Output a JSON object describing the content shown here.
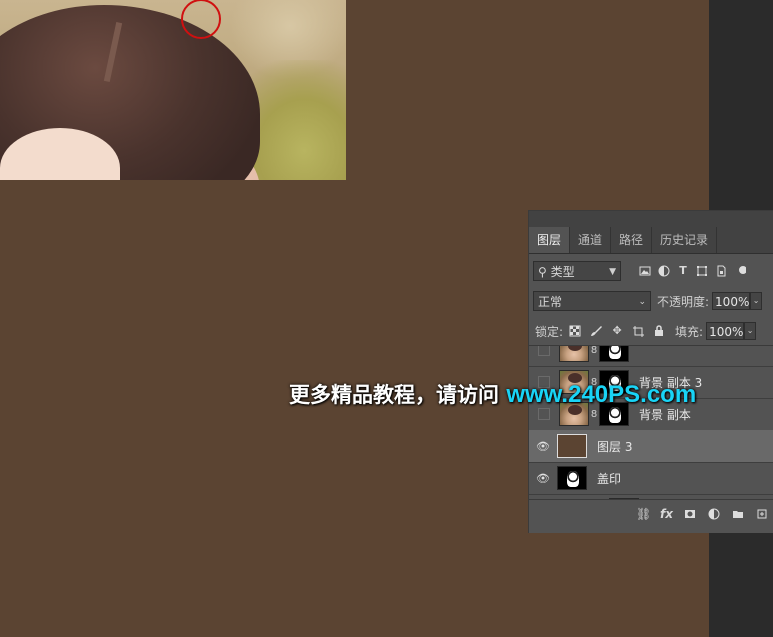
{
  "panel": {
    "tabs": [
      "图层",
      "通道",
      "路径",
      "历史记录"
    ],
    "active_tab": 0,
    "filter": {
      "label": "类型",
      "icons": [
        "image-filter-icon",
        "adjustment-filter-icon",
        "text-filter-icon",
        "shape-filter-icon",
        "smartobject-filter-icon"
      ]
    },
    "blend_mode": "正常",
    "opacity_label": "不透明度:",
    "opacity_value": "100%",
    "lock_label": "锁定:",
    "fill_label": "填充:",
    "fill_value": "100%",
    "layers": [
      {
        "name": "背景 副本 3",
        "visible": false,
        "thumb": "photo",
        "mask": true
      },
      {
        "name": "背景 副本",
        "visible": false,
        "thumb": "photo",
        "mask": true
      },
      {
        "name": "图层 3",
        "visible": true,
        "thumb": "fill",
        "selected": true
      },
      {
        "name": "盖印",
        "visible": true,
        "thumb": "mask"
      }
    ],
    "bottom_icons": [
      "link-icon",
      "fx-icon",
      "add-mask-icon",
      "adjustment-layer-icon",
      "group-folder-icon",
      "new-layer-icon"
    ],
    "fx_label": "fx"
  },
  "watermark": {
    "text": "更多精品教程，请访问 ",
    "url": "www.240PS.com"
  },
  "colors": {
    "canvas": "#5b4432",
    "panel": "#535353",
    "brush_circle": "#d01010",
    "url": "#19d4f6"
  }
}
